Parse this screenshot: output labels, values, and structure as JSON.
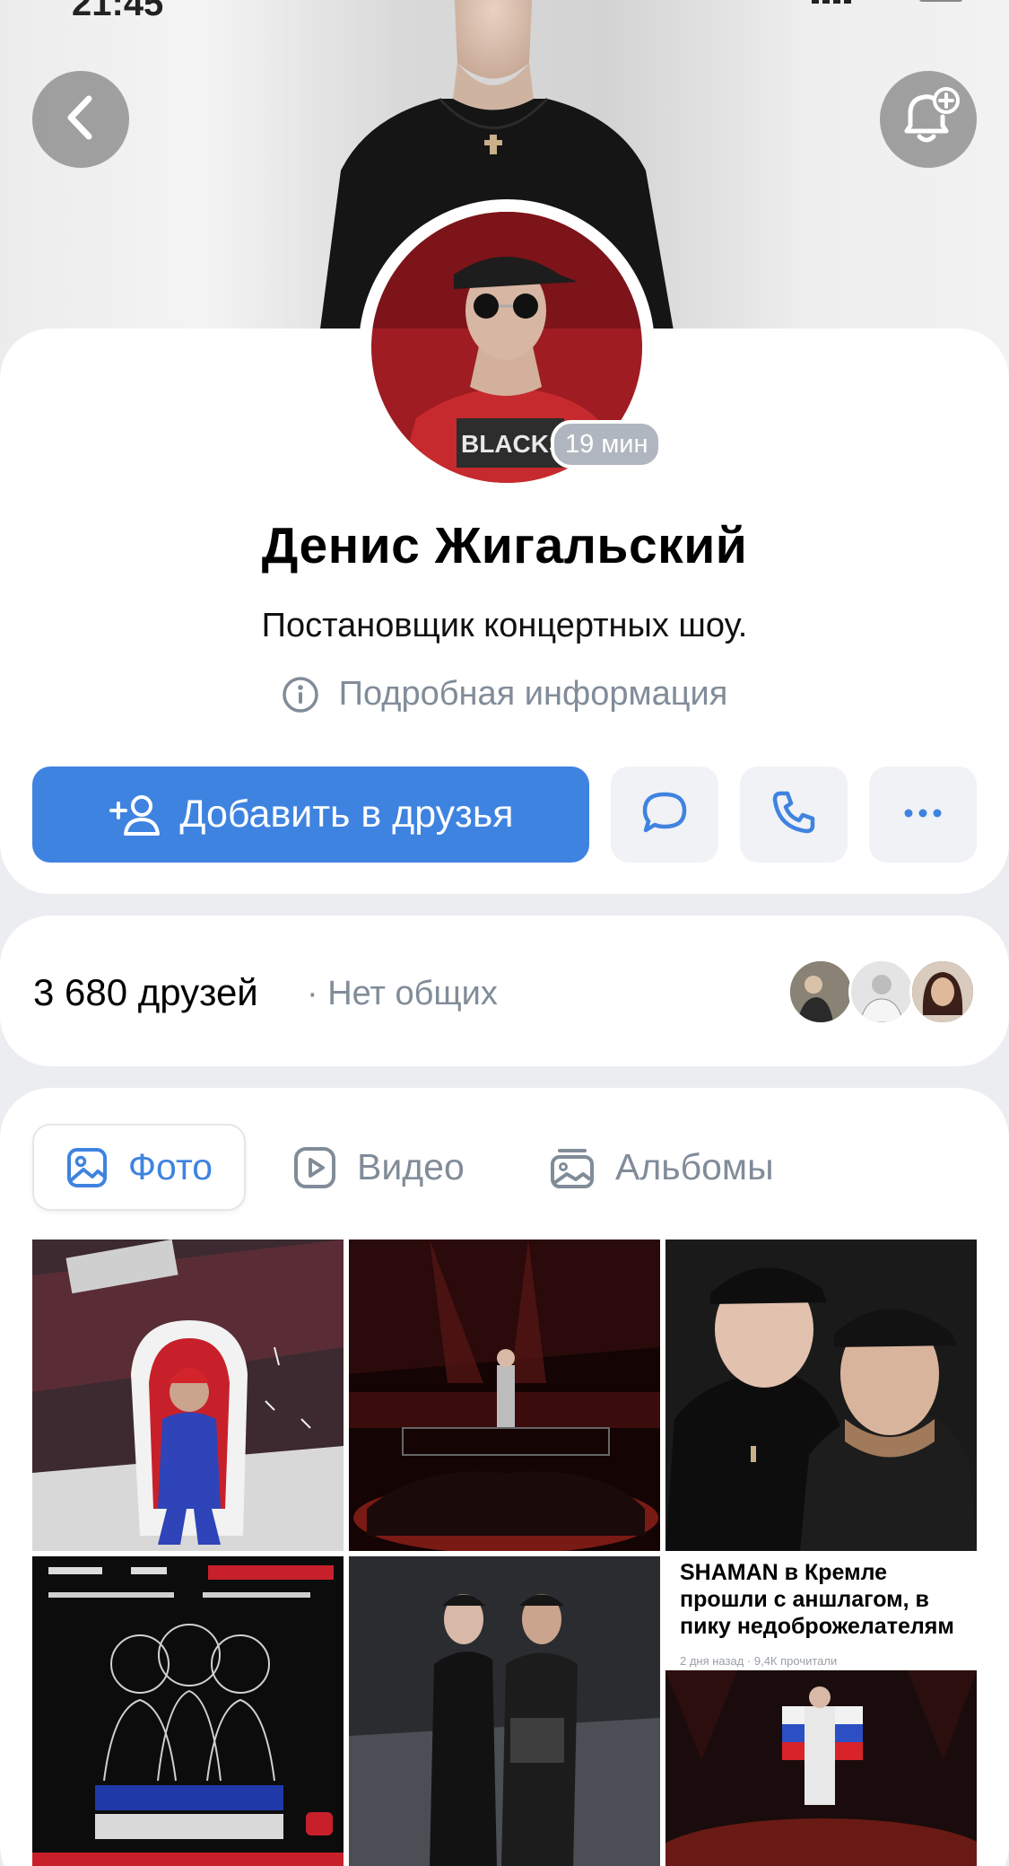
{
  "status_bar": {
    "time": "21:45"
  },
  "profile": {
    "name": "Денис Жигальский",
    "status": "Постановщик концертных шоу.",
    "more_info": "Подробная информация",
    "online": "19 мин"
  },
  "actions": {
    "add_friend": "Добавить в друзья"
  },
  "friends": {
    "count": "3 680 друзей",
    "mutual": "· Нет общих"
  },
  "tabs": [
    {
      "label": "Фото",
      "active": true
    },
    {
      "label": "Видео",
      "active": false
    },
    {
      "label": "Альбомы",
      "active": false
    }
  ],
  "news_photo": {
    "title": "SHAMAN в Кремле прошли с аншлагом, в пику недоброжелателям",
    "meta": "2 дня назад · 9,4К прочитали"
  },
  "colors": {
    "accent": "#3f83e0",
    "secondary_text": "#818c99",
    "background": "#ebedf0"
  },
  "icons": [
    "back-icon",
    "bell-plus-icon",
    "info-icon",
    "add-user-icon",
    "message-icon",
    "phone-icon",
    "more-icon",
    "photo-icon",
    "video-icon",
    "albums-icon"
  ]
}
